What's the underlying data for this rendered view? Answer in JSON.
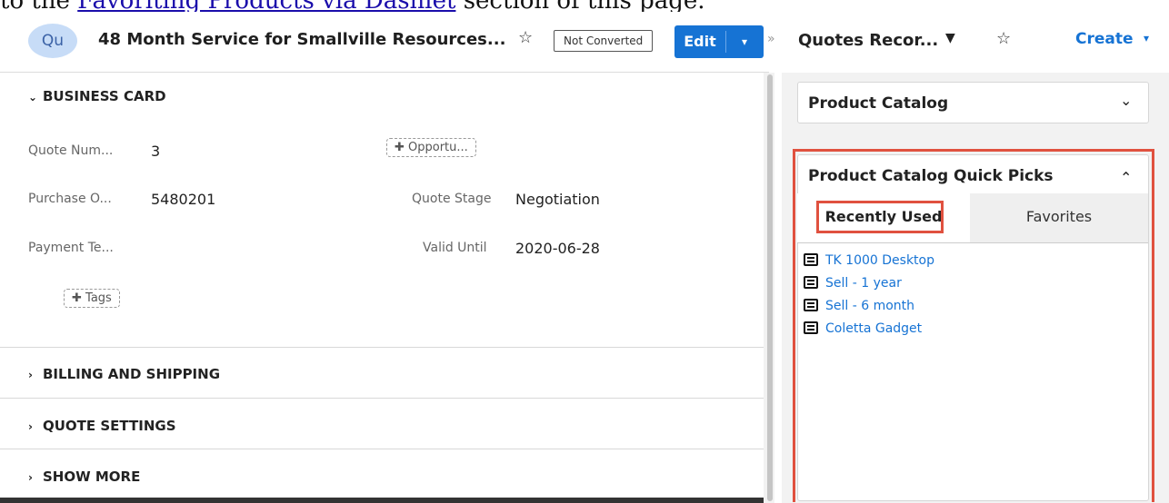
{
  "instruction": {
    "prefix": "to the ",
    "link": "Favoriting Products via Dashlet",
    "suffix": " section of this page."
  },
  "record_header": {
    "avatar": "Qu",
    "title": "48 Month Service for Smallville Resources...",
    "star": "☆",
    "badge": "Not Converted",
    "edit_label": "Edit",
    "edit_caret": "▾"
  },
  "business_card": {
    "title": "BUSINESS CARD",
    "chevron": "⌄",
    "fields": [
      {
        "label": "Quote Num...",
        "value": "3"
      },
      {
        "label": "Purchase O...",
        "value": "5480201"
      },
      {
        "label": "Payment Te...",
        "value": ""
      }
    ],
    "opportunity_pill": "✚ Opportu...",
    "right_fields": [
      {
        "label": "Quote Stage",
        "value": "Negotiation"
      },
      {
        "label": "Valid Until",
        "value": "2020-06-28"
      }
    ],
    "tags_pill": "✚ Tags"
  },
  "sections": [
    {
      "title": "BILLING AND SHIPPING",
      "chevron": "›"
    },
    {
      "title": "QUOTE SETTINGS",
      "chevron": "›"
    },
    {
      "title": "SHOW MORE",
      "chevron": "›"
    }
  ],
  "right_header": {
    "collapse": "»",
    "title": "Quotes Recor...",
    "caret": "▼",
    "star": "☆",
    "create": "Create",
    "create_caret": "▾"
  },
  "product_catalog": {
    "title": "Product Catalog",
    "caret": "⌄"
  },
  "quick_picks": {
    "title": "Product Catalog Quick Picks",
    "caret": "⌃",
    "tabs": [
      "Recently Used",
      "Favorites"
    ],
    "items": [
      "TK 1000 Desktop",
      "Sell - 1 year",
      "Sell - 6 month",
      "Coletta Gadget"
    ]
  },
  "colors": {
    "accent": "#1673d4",
    "highlight": "#e0513f"
  }
}
